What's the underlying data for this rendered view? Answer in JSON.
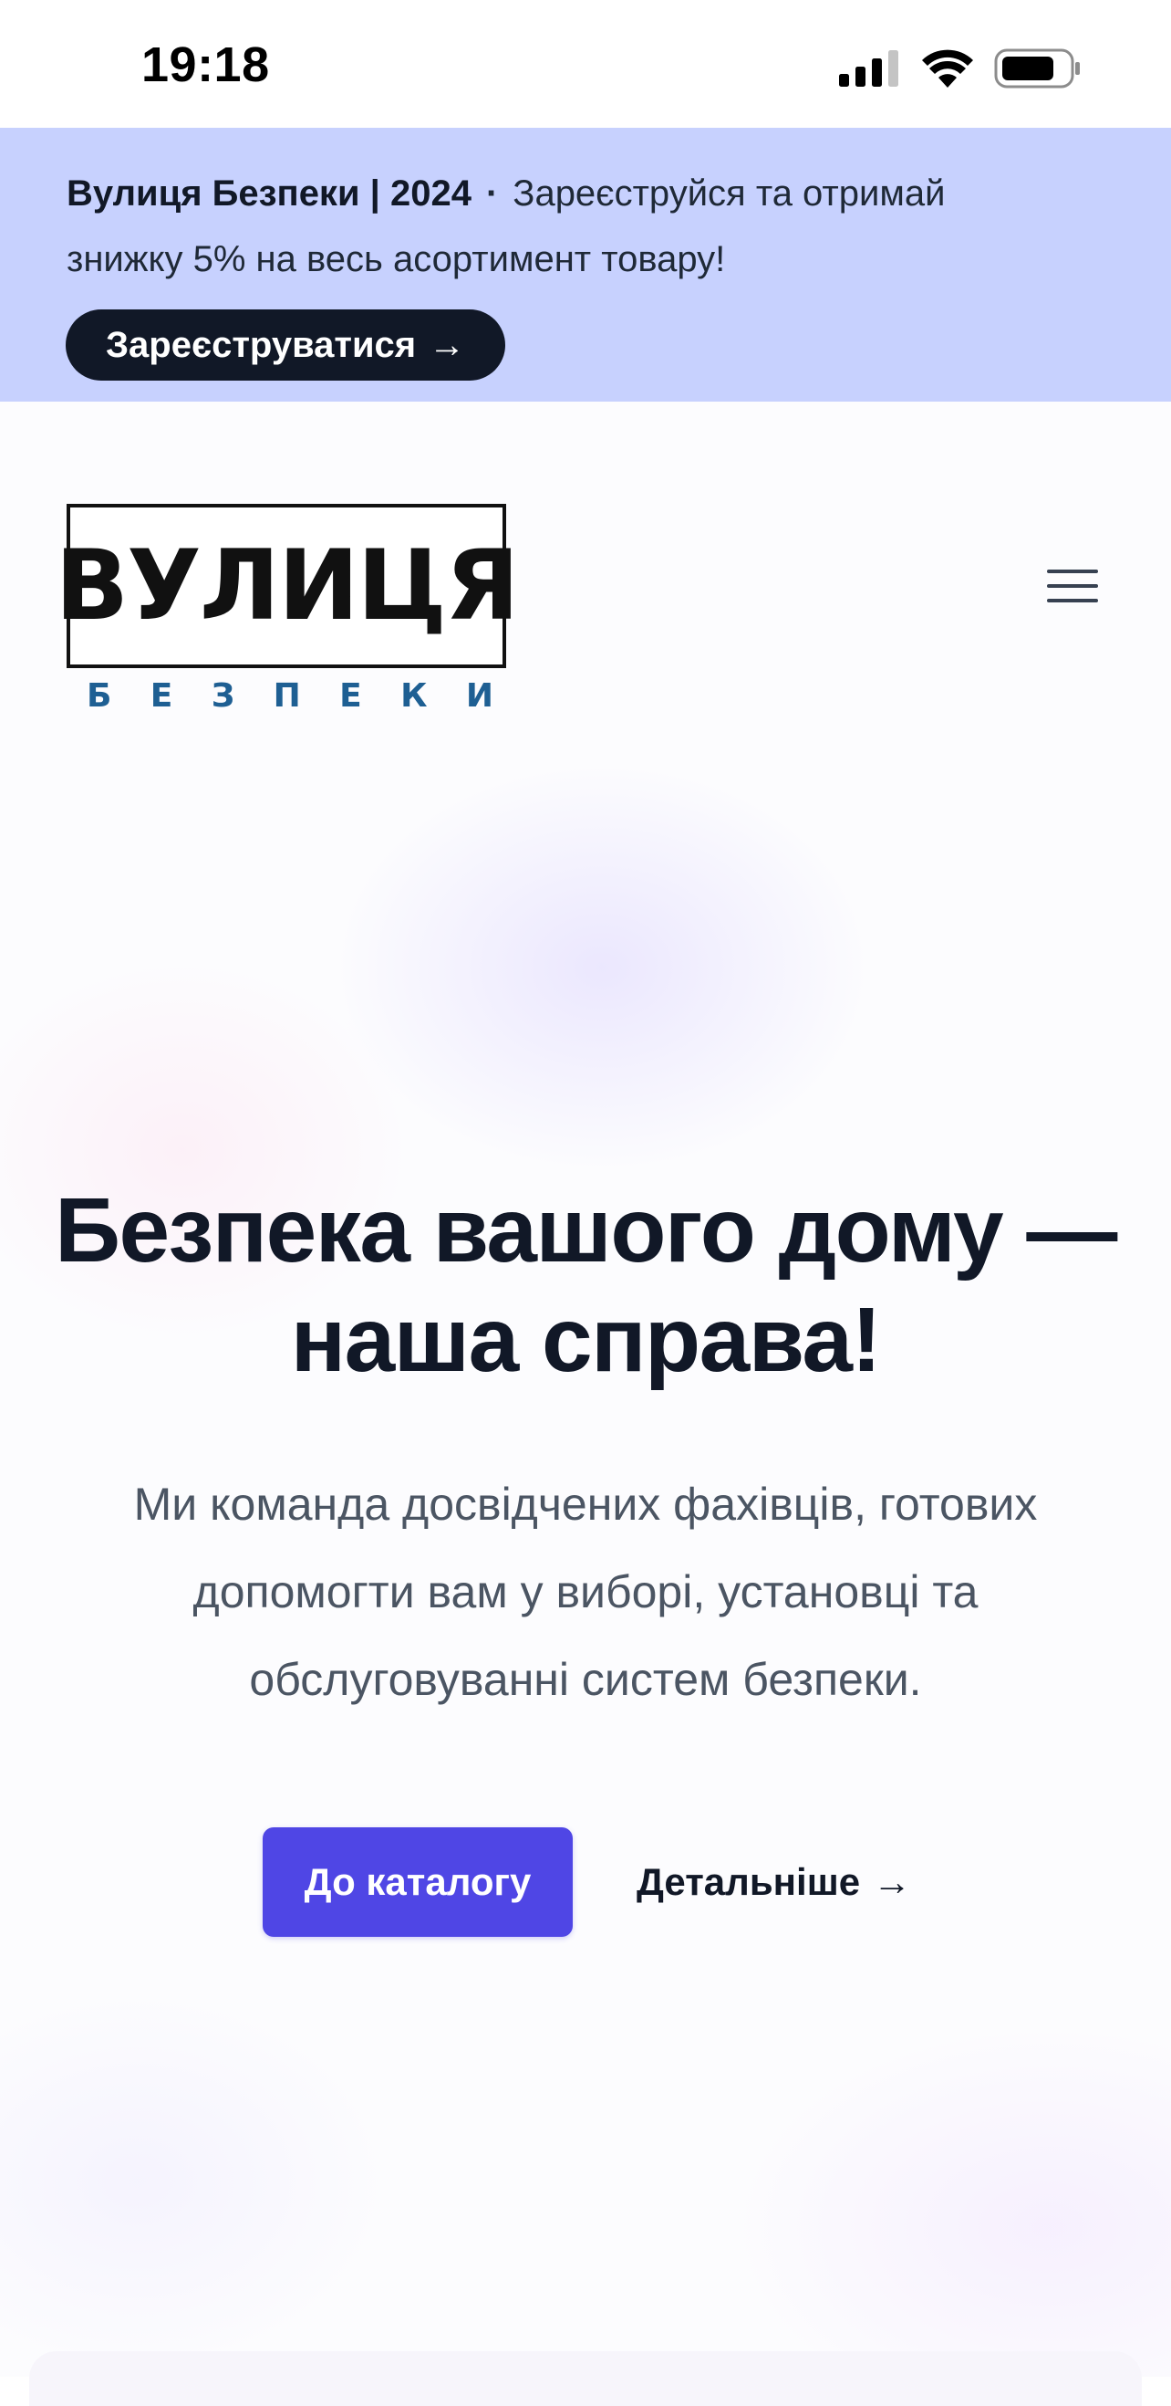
{
  "status_bar": {
    "time": "19:18",
    "icons": [
      "cellular-signal-icon",
      "wifi-icon",
      "battery-icon"
    ]
  },
  "banner": {
    "brand": "Вулиця Безпеки | 2024",
    "separator": "·",
    "message_line1": "Зареєструйся та отримай",
    "message_line2": "знижку 5% на весь асортимент товару!",
    "button_label": "Зареєструватися",
    "button_arrow": "→",
    "background_color": "#c7d1fe"
  },
  "header": {
    "logo_word": "ВУЛИЦЯ",
    "logo_sub_letters": [
      "Б",
      "Е",
      "З",
      "П",
      "Е",
      "К",
      "И"
    ],
    "menu_icon": "hamburger-menu-icon"
  },
  "hero": {
    "title_line1": "Безпека вашого дому —",
    "title_line2": "наша справа!",
    "description": "Ми команда досвідчених фахівців, готових допомогти вам у виборі, установці та обслуговуванні систем безпеки.",
    "primary_button": "До каталогу",
    "secondary_link": "Детальніше",
    "secondary_arrow": "→",
    "accent_color": "#4f46e5"
  }
}
